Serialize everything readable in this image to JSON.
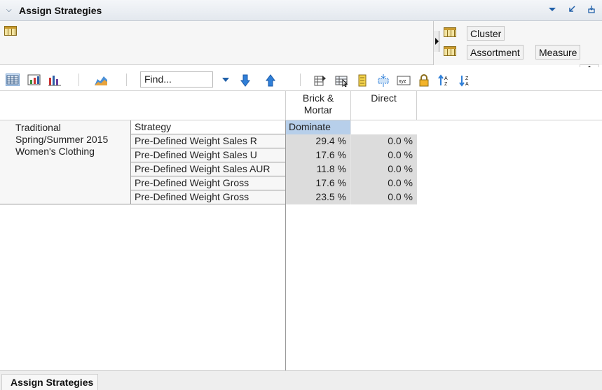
{
  "panel": {
    "title": "Assign Strategies",
    "controls": [
      "menu-dropdown-icon",
      "minimize-icon",
      "detach-icon"
    ]
  },
  "dimensions": {
    "cluster_label": "Cluster",
    "assortment_label": "Assortment",
    "measure_label": "Measure"
  },
  "toolbar": {
    "find_placeholder": "Find..."
  },
  "grid": {
    "columns": [
      "Brick &\nMortar",
      "Direct"
    ],
    "group_label": "Traditional\nSpring/Summer 2015\nWomen's Clothing",
    "rows": [
      {
        "label": "Strategy",
        "values": [
          "Dominate",
          ""
        ]
      },
      {
        "label": "Pre-Defined Weight Sales R",
        "values": [
          "29.4 %",
          "0.0 %"
        ]
      },
      {
        "label": "Pre-Defined Weight Sales U",
        "values": [
          "17.6 %",
          "0.0 %"
        ]
      },
      {
        "label": "Pre-Defined Weight Sales AUR",
        "values": [
          "11.8 %",
          "0.0 %"
        ]
      },
      {
        "label": "Pre-Defined Weight Gross",
        "values": [
          "17.6 %",
          "0.0 %"
        ]
      },
      {
        "label": "Pre-Defined Weight Gross",
        "values": [
          "23.5 %",
          "0.0 %"
        ]
      }
    ]
  },
  "tabs": [
    {
      "label": "Assign Strategies",
      "active": true
    }
  ]
}
